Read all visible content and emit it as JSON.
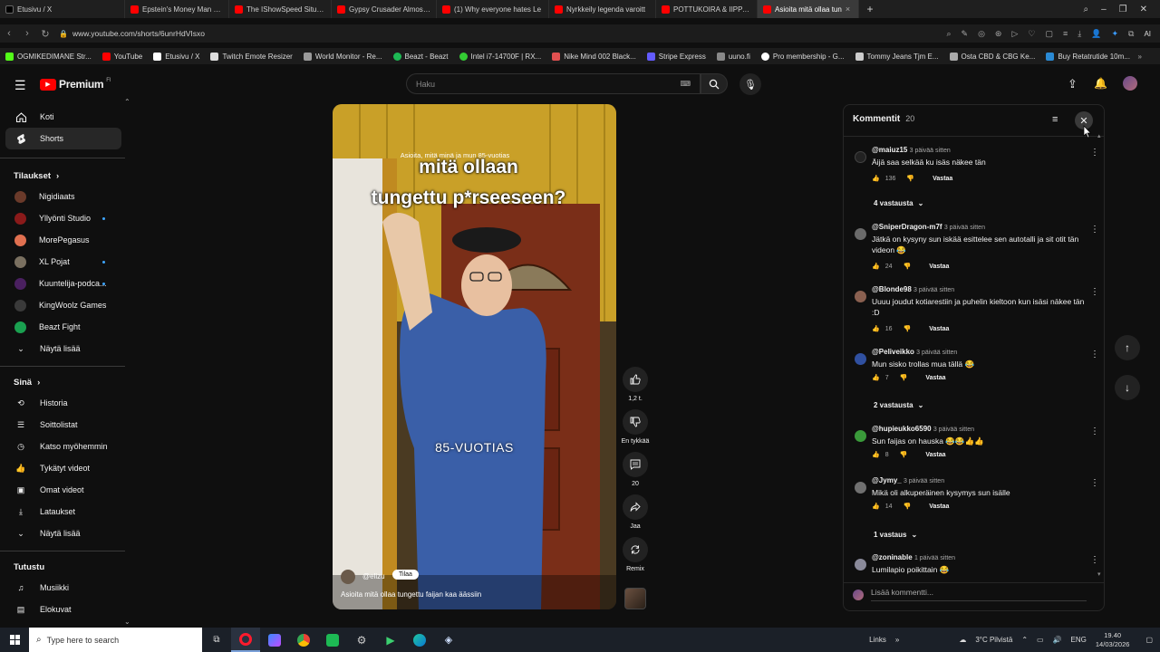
{
  "browser": {
    "tabs": [
      {
        "label": "Etusivu / X",
        "color": "#1d1d1d",
        "active": false
      },
      {
        "label": "Epstein's Money Man Spi",
        "color": "#ff0000",
        "active": false
      },
      {
        "label": "The IShowSpeed Situation",
        "color": "#ff0000",
        "active": false
      },
      {
        "label": "Gypsy Crusader Almost P",
        "color": "#ff0000",
        "active": false
      },
      {
        "label": "(1) Why everyone hates Le",
        "color": "#ff0000",
        "active": false
      },
      {
        "label": "Nyrkkeily legenda varoitt",
        "color": "#ff0000",
        "active": false
      },
      {
        "label": "POTTUKOIRA & IIPPADAA",
        "color": "#ff0000",
        "active": false
      },
      {
        "label": "Asioita mitä ollaa tun",
        "color": "#ff0000",
        "active": true
      }
    ],
    "url": "www.youtube.com/shorts/6unrHdVIsxo",
    "bookmarks": [
      {
        "label": "OGMIKEDIMANE Str...",
        "color": "#53fc18"
      },
      {
        "label": "YouTube",
        "color": "#ff0000"
      },
      {
        "label": "Etusivu / X",
        "color": "#ffffff"
      },
      {
        "label": "Twitch Emote Resizer",
        "color": "#dddddd"
      },
      {
        "label": "World Monitor - Re...",
        "color": "#9a9a9a"
      },
      {
        "label": "Beazt - Beazt",
        "color": "#1db954"
      },
      {
        "label": "Intel i7-14700F | RX...",
        "color": "#33cc33"
      },
      {
        "label": "Nike Mind 002 Black...",
        "color": "#e05050"
      },
      {
        "label": "Stripe Express",
        "color": "#635bff"
      },
      {
        "label": "uuno.fi",
        "color": "#888888"
      },
      {
        "label": "Pro membership - G...",
        "color": "#ffffff"
      },
      {
        "label": "Tommy Jeans Tjm E...",
        "color": "#cccccc"
      },
      {
        "label": "Osta CBD & CBG Ke...",
        "color": "#aaaaaa"
      },
      {
        "label": "Buy Retatrutide 10m...",
        "color": "#2a8ad4"
      }
    ]
  },
  "youtube": {
    "logo": "Premium",
    "logo_super": "FI",
    "search_placeholder": "Haku",
    "nav": [
      {
        "label": "Koti",
        "icon": "home-icon"
      },
      {
        "label": "Shorts",
        "icon": "shorts-icon",
        "active": true
      }
    ],
    "subs_header": "Tilaukset",
    "subscriptions": [
      {
        "label": "Nigidiaats",
        "color": "#6a3a2a",
        "dot": false
      },
      {
        "label": "Yllyönti Studio",
        "color": "#8a1a1a",
        "dot": true
      },
      {
        "label": "MorePegasus",
        "color": "#e07050",
        "dot": false
      },
      {
        "label": "XL Pojat",
        "color": "#7a7060",
        "dot": true
      },
      {
        "label": "Kuuntelija-podca...",
        "color": "#4a2060",
        "dot": true
      },
      {
        "label": "KingWoolz Games",
        "color": "#3a3a3a",
        "dot": false
      },
      {
        "label": "Beazt Fight",
        "color": "#1aa050",
        "dot": false
      }
    ],
    "show_more_1": "Näytä lisää",
    "you_header": "Sinä",
    "you_items": [
      {
        "label": "Historia",
        "icon": "history-icon"
      },
      {
        "label": "Soittolistat",
        "icon": "playlists-icon"
      },
      {
        "label": "Katso myöhemmin",
        "icon": "watch-later-icon"
      },
      {
        "label": "Tykätyt videot",
        "icon": "liked-icon"
      },
      {
        "label": "Omat videot",
        "icon": "your-videos-icon"
      },
      {
        "label": "Lataukset",
        "icon": "downloads-icon"
      },
      {
        "label": "Näytä lisää",
        "icon": "chevron-down-icon"
      }
    ],
    "explore_header": "Tutustu",
    "explore_items": [
      {
        "label": "Musiikki",
        "icon": "music-icon"
      },
      {
        "label": "Elokuvat",
        "icon": "movies-icon"
      }
    ]
  },
  "video": {
    "caption_small": "Asioita, mitä minä ja mun 85-vuotias",
    "caption_line1": "mitä ollaan",
    "caption_line2": "tungettu p*rseeseen?",
    "caption_mid": "85-VUOTIAS",
    "channel": "@elizu",
    "subscribe_label": "Tilaa",
    "title": "Asioita mitä ollaa tungettu faijan kaa äässiin",
    "likes": "1,2 t.",
    "dislike_label": "En tykkää",
    "comments_count": "20",
    "share_label": "Jaa",
    "remix_label": "Remix"
  },
  "comments": {
    "title": "Kommentit",
    "count": "20",
    "add_placeholder": "Lisää kommentti...",
    "items": [
      {
        "handle": "@maiuz15",
        "time": "3 päivää sitten",
        "text": "Äijä saa selkää ku isäs näkee tän",
        "likes": "136",
        "reply": "Vastaa",
        "replies": "4 vastausta",
        "color": "#222222"
      },
      {
        "handle": "@SniperDragon-m7f",
        "time": "3 päivää sitten",
        "text": "Jätkä on kysyny sun iskää esittelee sen autotalli ja sit otit tän videon 😂",
        "likes": "24",
        "reply": "Vastaa",
        "replies": "",
        "color": "#6a6a6a"
      },
      {
        "handle": "@Blonde98",
        "time": "3 päivää sitten",
        "text": "Uuuu joudut kotiarestiin ja puhelin kieltoon kun isäsi näkee tän :D",
        "likes": "16",
        "reply": "Vastaa",
        "replies": "",
        "color": "#8a6050"
      },
      {
        "handle": "@Peliveikko",
        "time": "3 päivää sitten",
        "text": "Mun sisko trollas mua tällä 😂",
        "likes": "7",
        "reply": "Vastaa",
        "replies": "2 vastausta",
        "color": "#3050a0"
      },
      {
        "handle": "@hupieukko6590",
        "time": "3 päivää sitten",
        "text": "Sun faijas on hauska 😂😂👍👍",
        "likes": "8",
        "reply": "Vastaa",
        "replies": "",
        "color": "#3a9a3a"
      },
      {
        "handle": "@Jymy_",
        "time": "3 päivää sitten",
        "text": "Mikä oli alkuperäinen kysymys sun isälle",
        "likes": "14",
        "reply": "Vastaa",
        "replies": "1 vastaus",
        "color": "#707070"
      },
      {
        "handle": "@zoninable",
        "time": "1 päivää sitten",
        "text": "Lumilapio poikittain 😂",
        "likes": "",
        "reply": "",
        "replies": "",
        "color": "#8a8a9a"
      }
    ]
  },
  "taskbar": {
    "search_placeholder": "Type here to search",
    "links": "Links",
    "weather": "3°C Pilvistä",
    "lang": "ENG",
    "time": "19.40",
    "date": "14/03/2026"
  }
}
